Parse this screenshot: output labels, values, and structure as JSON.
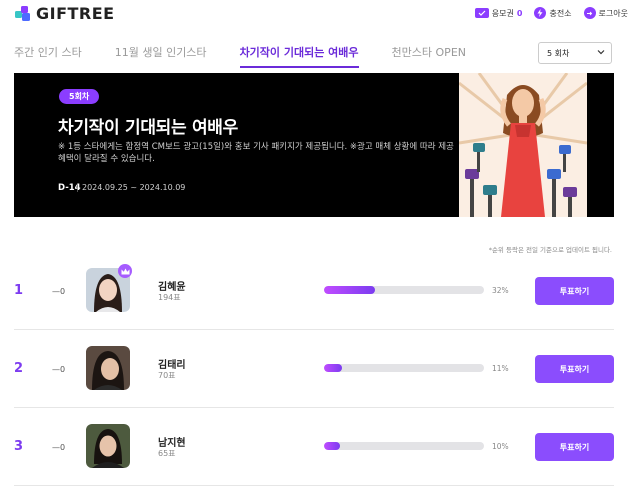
{
  "header": {
    "logo_text": "GIFTREE",
    "vote_ticket_label": "응모권",
    "vote_ticket_count": "0",
    "charge_label": "충전소",
    "logout_label": "로그아웃"
  },
  "tabs": [
    {
      "label": "주간 인기 스타",
      "active": false
    },
    {
      "label": "11월 생일 인기스타",
      "active": false
    },
    {
      "label": "차기작이 기대되는 여배우",
      "active": true
    },
    {
      "label": "천만스타 OPEN",
      "active": false
    }
  ],
  "round_select": {
    "value": "5 회차"
  },
  "banner": {
    "badge": "5회차",
    "title": "차기작이 기대되는 여배우",
    "description": "※ 1등 스타에게는 합정역 CM보드 광고(15일)와 홍보 기사 패키지가 제공됩니다. ※광고 매체 상황에 따라 제공 혜택이 달라질 수 있습니다.",
    "dday": "D-14",
    "period": "2024.09.25 ~ 2024.10.09"
  },
  "notice": "*순위 등락은 전일 기준으로 업데이트 됩니다.",
  "rankings": [
    {
      "rank": "1",
      "change": "—0",
      "name": "김혜윤",
      "votes": "194표",
      "percent_label": "32%",
      "percent": 32,
      "button": "투표하기",
      "crown": true
    },
    {
      "rank": "2",
      "change": "—0",
      "name": "김태리",
      "votes": "70표",
      "percent_label": "11%",
      "percent": 11,
      "button": "투표하기",
      "crown": false
    },
    {
      "rank": "3",
      "change": "—0",
      "name": "남지현",
      "votes": "65표",
      "percent_label": "10%",
      "percent": 10,
      "button": "투표하기",
      "crown": false
    }
  ],
  "colors": {
    "accent": "#8b4dfd",
    "rank": "#7d3cf0",
    "banner_bg": "#000000"
  }
}
